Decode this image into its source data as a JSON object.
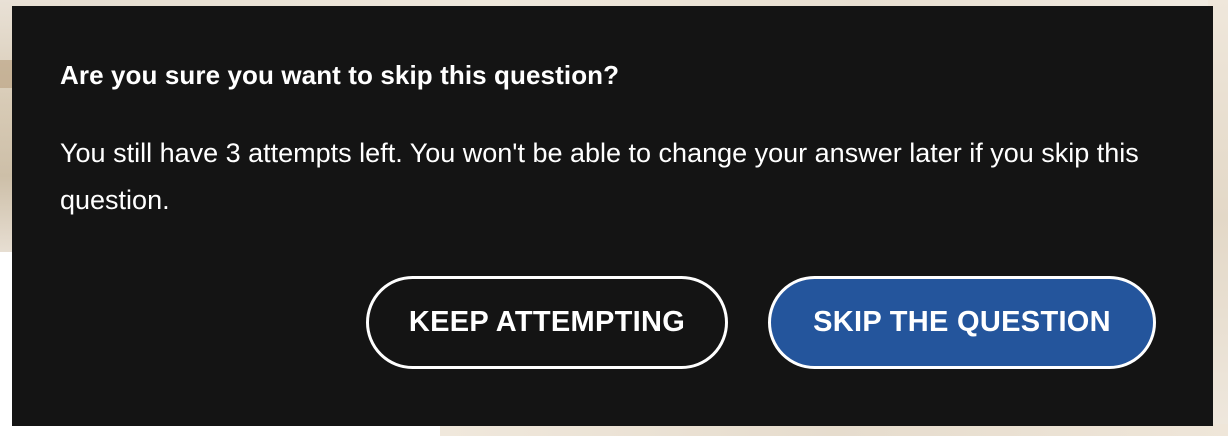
{
  "dialog": {
    "title": "Are you sure you want to skip this question?",
    "message": "You still have 3 attempts left. You won't be able to change your answer later if you skip this question.",
    "buttons": {
      "keep_label": "KEEP ATTEMPTING",
      "skip_label": "SKIP THE QUESTION"
    }
  },
  "colors": {
    "dialog_background": "#141414",
    "text": "#ffffff",
    "skip_button_background": "#24559c",
    "button_border": "#ffffff"
  }
}
